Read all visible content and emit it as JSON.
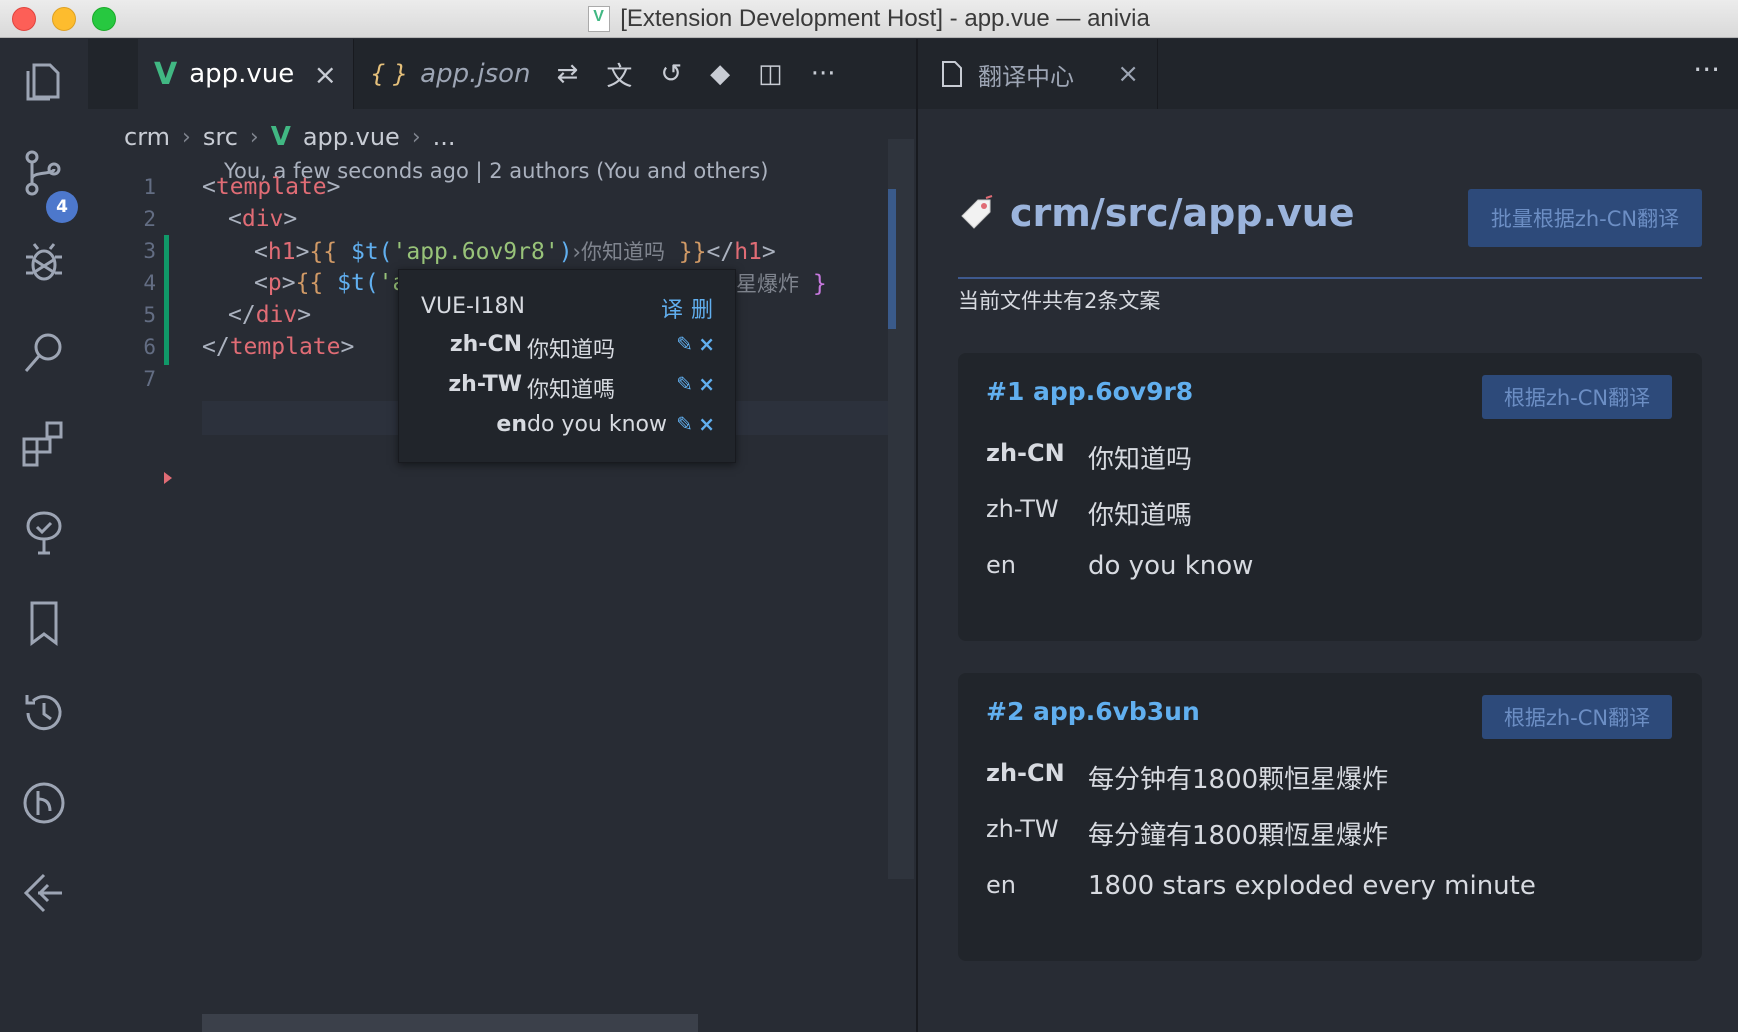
{
  "window": {
    "title": "[Extension Development Host] - app.vue — anivia"
  },
  "activity_bar": {
    "scm_badge": "4"
  },
  "editor": {
    "tabs": [
      {
        "label": "app.vue",
        "icon": "vue-icon"
      },
      {
        "label": "app.json",
        "icon": "json-icon"
      }
    ],
    "toolbar_icons": [
      "compare-changes-icon",
      "translate-icon",
      "open-changes-icon",
      "git-icon",
      "split-editor-icon",
      "more-actions-icon"
    ],
    "breadcrumb": [
      "crm",
      "src",
      "app.vue",
      "..."
    ],
    "codelens": "You, a few seconds ago | 2 authors (You and others)",
    "line_numbers": [
      "1",
      "2",
      "3",
      "4",
      "5",
      "6",
      "7"
    ],
    "code": {
      "l1_open": "<",
      "l1_tag": "template",
      "l1_close": ">",
      "l2_open": "<",
      "l2_tag": "div",
      "l2_close": ">",
      "l3_open": "<",
      "l3_tag": "h1",
      "l3_close": ">",
      "l3_mustache_open": "{{",
      "l3_fn": " $t(",
      "l3_str": "'app.6ov9r8'",
      "l3_paren": ")",
      "l3_hint": "›你知道吗",
      "l3_mustache_close": " }}",
      "l3_end_open": "</",
      "l3_end_tag": "h1",
      "l3_end_close": ">",
      "l4_open": "<",
      "l4_tag": "p",
      "l4_close": ">",
      "l4_mustache_open": "{{",
      "l4_fn": " $t(",
      "l4_str": "'a",
      "l4_hint_tail": "星爆炸",
      "l4_mustache_close": " }",
      "l5_open": "</",
      "l5_tag": "div",
      "l5_close": ">",
      "l6_open": "</",
      "l6_tag": "template",
      "l6_close": ">"
    },
    "hover": {
      "title": "VUE-I18N",
      "action_translate": "译",
      "action_delete": "删",
      "rows": [
        {
          "lang": "zh-CN",
          "value": "你知道吗"
        },
        {
          "lang": "zh-TW",
          "value": "你知道嗎"
        },
        {
          "lang": "en",
          "value": "do you know"
        }
      ],
      "edit_glyph": "✎",
      "delete_glyph": "×"
    }
  },
  "panel": {
    "tab_label": "翻译中心",
    "more_glyph": "···",
    "file_title": "crm/src/app.vue",
    "batch_button": "批量根据zh-CN翻译",
    "summary": "当前文件共有2条文案",
    "entries": [
      {
        "key": "#1 app.6ov9r8",
        "button": "根据zh-CN翻译",
        "rows": [
          {
            "lang": "zh-CN",
            "value": "你知道吗"
          },
          {
            "lang": "zh-TW",
            "value": "你知道嗎"
          },
          {
            "lang": "en",
            "value": "do you know"
          }
        ]
      },
      {
        "key": "#2 app.6vb3un",
        "button": "根据zh-CN翻译",
        "rows": [
          {
            "lang": "zh-CN",
            "value": "每分钟有1800颗恒星爆炸"
          },
          {
            "lang": "zh-TW",
            "value": "每分鐘有1800顆恆星爆炸"
          },
          {
            "lang": "en",
            "value": "1800 stars exploded every minute"
          }
        ]
      }
    ]
  },
  "colors": {
    "accent": "#61afef",
    "vue": "#41b883",
    "tag": "#e06c75",
    "string": "#98c379",
    "button_bg": "#2d4a7a"
  }
}
